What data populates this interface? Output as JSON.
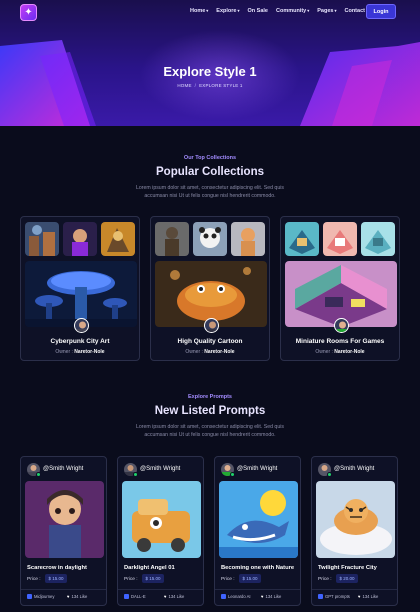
{
  "nav": {
    "logo_icon": "hexagon-logo-icon",
    "items": [
      {
        "label": "Home",
        "caret": "▾"
      },
      {
        "label": "Explore",
        "caret": "▾"
      },
      {
        "label": "On Sale",
        "caret": ""
      },
      {
        "label": "Community",
        "caret": "▾"
      },
      {
        "label": "Pages",
        "caret": "▾"
      },
      {
        "label": "Contact",
        "caret": ""
      }
    ],
    "login_label": "Login"
  },
  "hero": {
    "title": "Explore Style 1",
    "breadcrumb": {
      "home": "HOME",
      "separator": "/",
      "current": "EXPLORE STYLE 1"
    }
  },
  "collections": {
    "eyebrow": "Our Top Collections",
    "title": "Popular Collections",
    "description_line1": "Lorem ipsum dolor sit amet, consectetur adipiscing elit. Sed quis",
    "description_line2": "accumsan nisi Ut ut felis congue nisl hendrerit commodo.",
    "owner_label": "Owner :",
    "items": [
      {
        "title": "Cyberpunk City Art",
        "owner": "Naretor-Nole"
      },
      {
        "title": "High Quality Cartoon",
        "owner": "Naretor-Nole"
      },
      {
        "title": "Miniature Rooms For Games",
        "owner": "Naretor-Nole"
      }
    ]
  },
  "prompts": {
    "eyebrow": "Explore Prompts",
    "title": "New Listed Prompts",
    "description_line1": "Lorem ipsum dolor sit amet, consectetur adipiscing elit. Sed quis",
    "description_line2": "accumsan nisi Ut ut felis congue nisl hendrerit commodo.",
    "price_label": "Price :",
    "items": [
      {
        "author": "@Smith Wright",
        "title": "Scarecrow in daylight",
        "price": "$ 15.00",
        "platform": "Midjourney",
        "likes": "134 Like"
      },
      {
        "author": "@Smith Wright",
        "title": "Darklight Angel 01",
        "price": "$ 15.00",
        "platform": "DALL-E",
        "likes": "134 Like"
      },
      {
        "author": "@Smith Wright",
        "title": "Becoming one with Nature",
        "price": "$ 15.00",
        "platform": "Leonardo AI",
        "likes": "134 Like"
      },
      {
        "author": "@Smith Wright",
        "title": "Twilight Fracture City",
        "price": "$ 20.00",
        "platform": "GPT prompts",
        "likes": "134 Like"
      }
    ]
  },
  "colors": {
    "accent": "#3a36d6",
    "eyebrow": "#a38cff",
    "online": "#1fd16a",
    "background": "#0a0c1c"
  }
}
